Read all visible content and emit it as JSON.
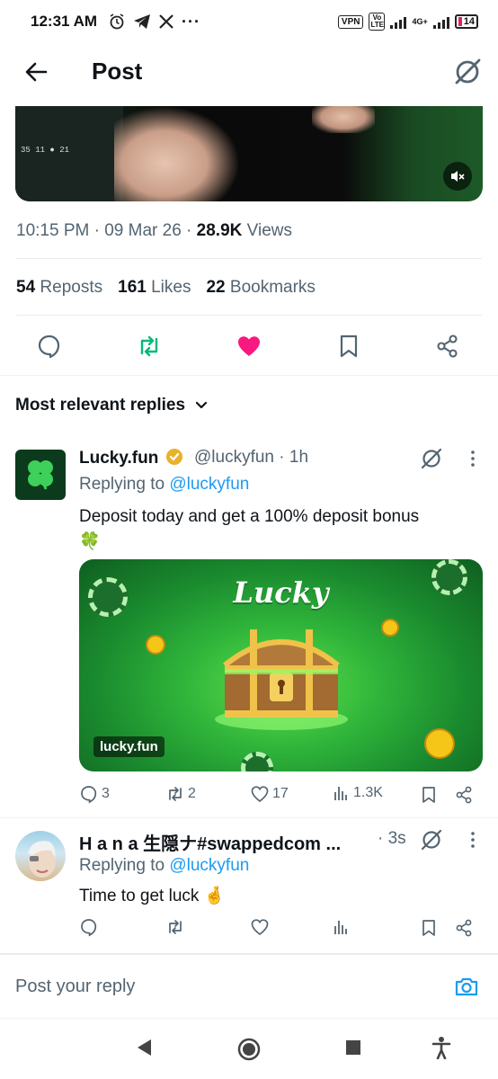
{
  "status": {
    "time": "12:31 AM",
    "vpn": "VPN",
    "volte": "Vo LTE",
    "net": "4G+",
    "battery": "14"
  },
  "header": {
    "title": "Post"
  },
  "post": {
    "video_overlay": "35  11  ●  21",
    "time": "10:15 PM",
    "date": "09 Mar 26",
    "views_count": "28.9K",
    "views_label": "Views",
    "reposts_count": "54",
    "reposts_label": "Reposts",
    "likes_count": "161",
    "likes_label": "Likes",
    "bookmarks_count": "22",
    "bookmarks_label": "Bookmarks"
  },
  "replies_filter": "Most relevant replies",
  "reply1": {
    "name": "Lucky.fun",
    "handle": "@luckyfun",
    "age": "1h",
    "replying_prefix": "Replying to",
    "replying_to": "@luckyfun",
    "text": "Deposit today and get a 100% deposit bonus",
    "text_emoji": "🍀",
    "promo_title": "Lucky",
    "promo_domain": "lucky.fun",
    "replies": "3",
    "reposts": "2",
    "likes": "17",
    "views": "1.3K"
  },
  "reply2": {
    "name": "H a n a 生隠ナ#swappedcom ...",
    "age": "3s",
    "replying_prefix": "Replying to",
    "replying_to": "@luckyfun",
    "text": "Time to get luck 🤞"
  },
  "composer": {
    "placeholder": "Post your reply"
  },
  "colors": {
    "accent": "#1d9bf0",
    "repost_green": "#00ba7c",
    "like_pink": "#f91880",
    "muted": "#536471"
  }
}
